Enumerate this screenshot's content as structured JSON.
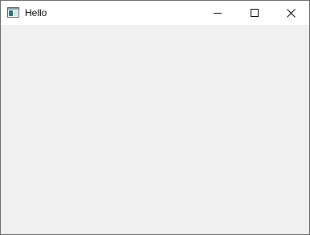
{
  "window": {
    "title": "Hello",
    "icons": {
      "app": "app-window-icon",
      "minimize": "minimize-icon",
      "maximize": "maximize-icon",
      "close": "close-icon"
    },
    "colors": {
      "titlebar_background": "#ffffff",
      "client_background": "#f0f0f0",
      "border": "#6b6b6b"
    }
  }
}
